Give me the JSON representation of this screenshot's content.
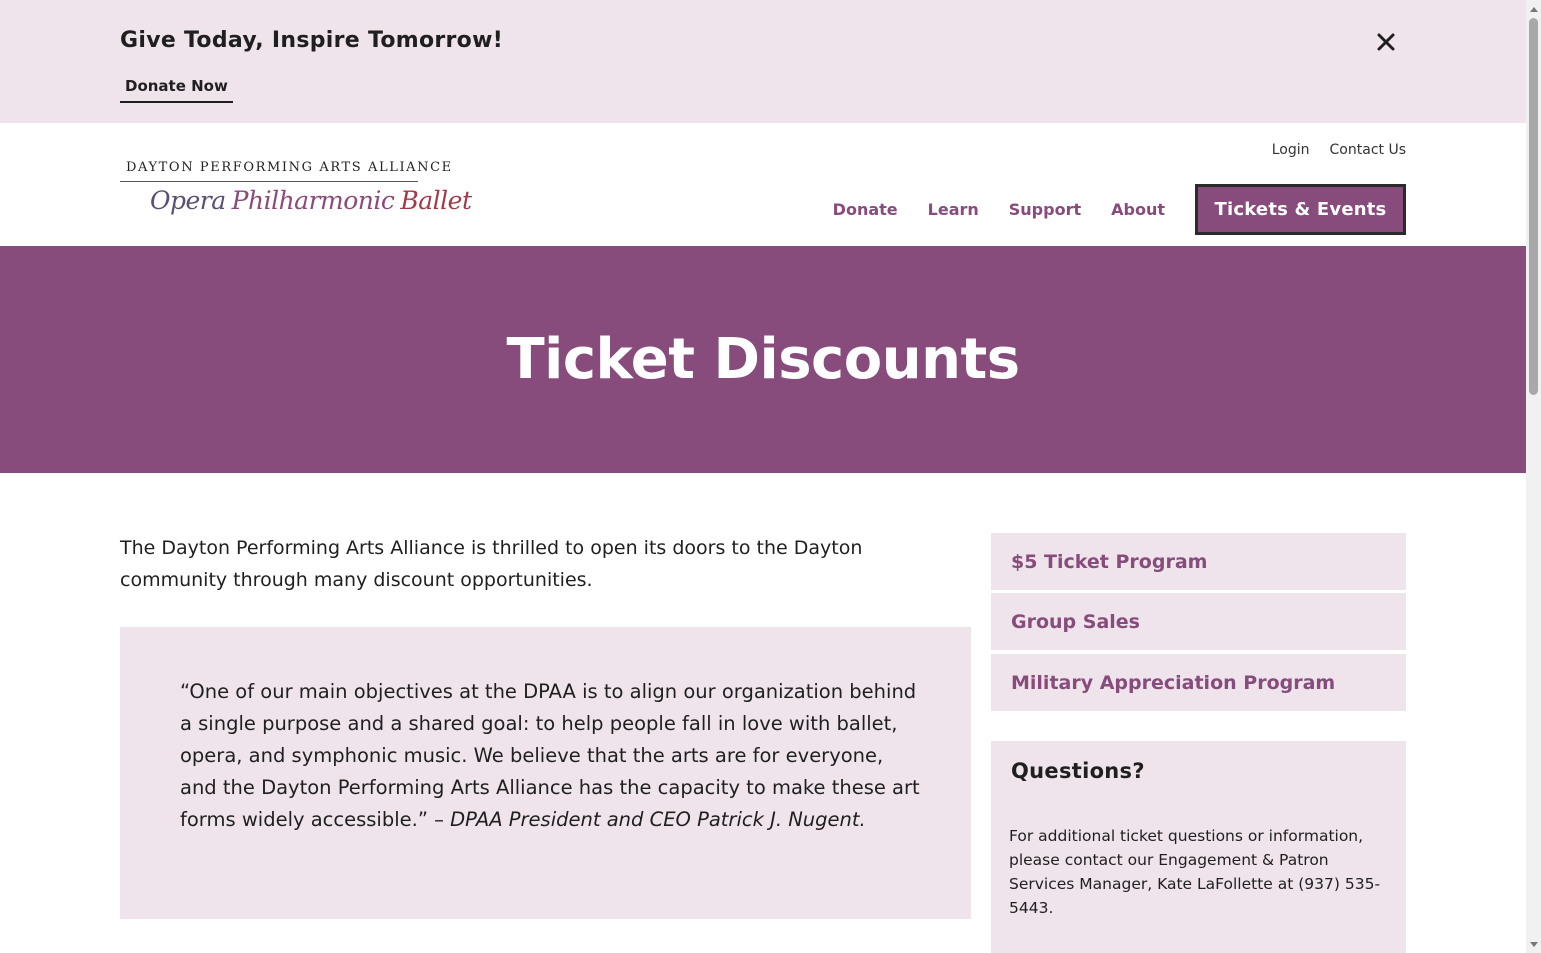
{
  "promo": {
    "title": "Give Today, Inspire Tomorrow!",
    "donate_label": "Donate Now",
    "close_icon": "close-icon"
  },
  "logo": {
    "top_text": "DAYTON PERFORMING ARTS ALLIANCE",
    "opera": "Opera",
    "philharmonic": "Philharmonic",
    "ballet": "Ballet"
  },
  "util_nav": {
    "login": "Login",
    "contact": "Contact Us"
  },
  "main_nav": {
    "items": [
      {
        "label": "Donate"
      },
      {
        "label": "Learn"
      },
      {
        "label": "Support"
      },
      {
        "label": "About"
      }
    ],
    "cta": "Tickets & Events"
  },
  "hero": {
    "title": "Ticket Discounts"
  },
  "content": {
    "intro": "The Dayton Performing Arts Alliance is thrilled to open its doors to the Dayton community through many discount opportunities.",
    "quote": "“One of our main objectives at the DPAA is to align our organization behind a single purpose and a shared goal: to help people fall in love with ballet, opera, and symphonic music. We believe that the arts are for everyone, and the Dayton Performing Arts Alliance has the capacity to make these art forms widely accessible.” – ",
    "quote_attribution": "DPAA President and CEO Patrick J. Nugent."
  },
  "sidebar": {
    "links": [
      {
        "label": "$5 Ticket Program"
      },
      {
        "label": "Group Sales"
      },
      {
        "label": "Military Appreciation Program"
      }
    ],
    "questions": {
      "title": "Questions?",
      "body": "For additional ticket questions or information, please contact our Engagement & Patron Services Manager, Kate LaFollette at (937) 535-5443."
    }
  },
  "colors": {
    "brand_purple": "#874b7c",
    "light_mauve": "#efe4ec",
    "text": "#1f1f1f"
  }
}
